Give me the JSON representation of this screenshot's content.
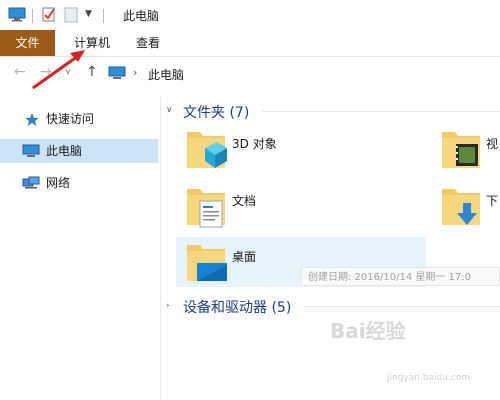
{
  "window": {
    "title": "此电脑"
  },
  "ribbon": {
    "tabs": [
      "文件",
      "计算机",
      "查看"
    ]
  },
  "navbar": {
    "path": "此电脑"
  },
  "navpane": {
    "items": [
      {
        "label": "快速访问",
        "icon": "star-icon"
      },
      {
        "label": "此电脑",
        "icon": "computer-icon",
        "selected": true
      },
      {
        "label": "网络",
        "icon": "network-icon"
      }
    ]
  },
  "groups": {
    "folders": {
      "title": "文件夹 (7)"
    },
    "devices": {
      "title": "设备和驱动器 (5)"
    }
  },
  "folders": [
    {
      "label": "3D 对象",
      "icon": "3d-objects-folder-icon"
    },
    {
      "label": "视",
      "icon": "video-folder-icon"
    },
    {
      "label": "文档",
      "icon": "documents-folder-icon"
    },
    {
      "label": "下",
      "icon": "downloads-folder-icon"
    },
    {
      "label": "桌面",
      "icon": "desktop-folder-icon"
    }
  ],
  "tooltip": {
    "text": "创建日期: 2016/10/14 星期一 17:0"
  },
  "watermark": {
    "text": "Bai经验",
    "sub": "jingyan.baidu.com"
  },
  "colors": {
    "file_tab": "#9c5b17",
    "accent": "#1e3a8a",
    "selected": "#cce4f7",
    "arrow": "#d82020"
  }
}
